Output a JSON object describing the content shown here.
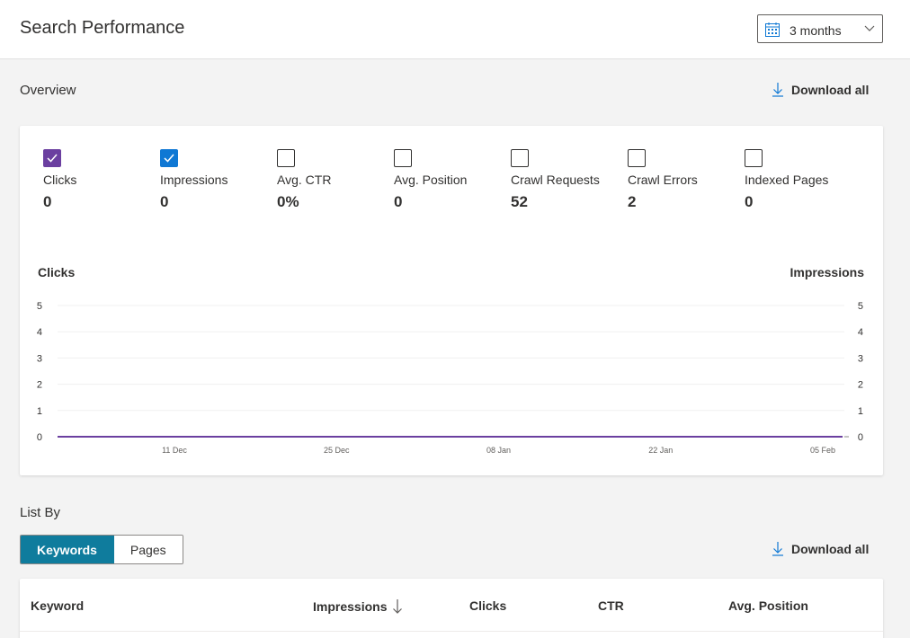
{
  "header": {
    "title": "Search Performance",
    "date_range": "3 months"
  },
  "overview": {
    "title": "Overview",
    "download_label": "Download all"
  },
  "metrics": [
    {
      "label": "Clicks",
      "value": "0",
      "checked": true,
      "color": "#6b3fa0"
    },
    {
      "label": "Impressions",
      "value": "0",
      "checked": true,
      "color": "#0f78d4"
    },
    {
      "label": "Avg. CTR",
      "value": "0%",
      "checked": false
    },
    {
      "label": "Avg. Position",
      "value": "0",
      "checked": false
    },
    {
      "label": "Crawl Requests",
      "value": "52",
      "checked": false
    },
    {
      "label": "Crawl Errors",
      "value": "2",
      "checked": false
    },
    {
      "label": "Indexed Pages",
      "value": "0",
      "checked": false
    }
  ],
  "chart_data": {
    "type": "line",
    "left_axis_label": "Clicks",
    "right_axis_label": "Impressions",
    "y_ticks": [
      0,
      1,
      2,
      3,
      4,
      5
    ],
    "ylim": [
      0,
      5
    ],
    "x_ticks": [
      "11 Dec",
      "25 Dec",
      "08 Jan",
      "22 Jan",
      "05 Feb"
    ],
    "series": [
      {
        "name": "Clicks",
        "color": "#6b3fa0",
        "values": [
          0,
          0,
          0,
          0,
          0
        ]
      },
      {
        "name": "Impressions",
        "color": "#0f78d4",
        "values": [
          0,
          0,
          0,
          0,
          0
        ]
      }
    ],
    "grid": true
  },
  "list_by": {
    "title": "List By",
    "options": [
      "Keywords",
      "Pages"
    ],
    "active": "Keywords",
    "download_label": "Download all"
  },
  "table": {
    "columns": [
      "Keyword",
      "Impressions",
      "Clicks",
      "CTR",
      "Avg. Position"
    ],
    "sort_column": "Impressions"
  }
}
